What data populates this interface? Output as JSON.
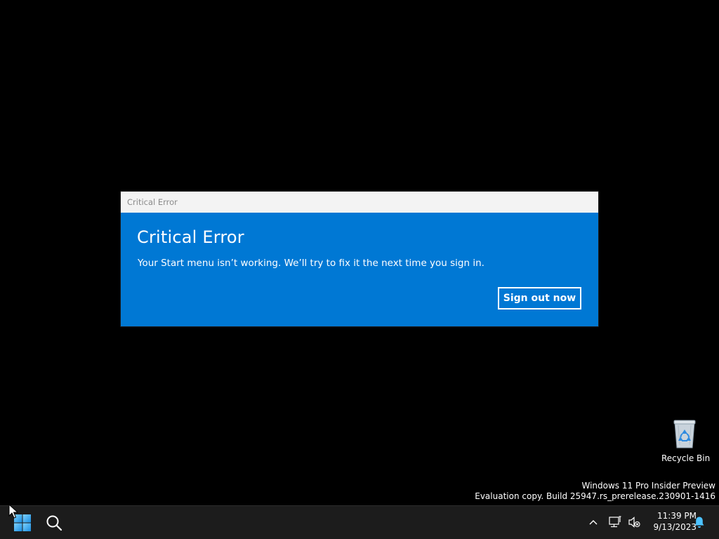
{
  "dialog": {
    "window_title": "Critical Error",
    "heading": "Critical Error",
    "message": "Your Start menu isn’t working. We’ll try to fix it the next time you sign in.",
    "button_label": "Sign out now",
    "accent_color": "#0078d4"
  },
  "desktop": {
    "recycle_bin_label": "Recycle Bin",
    "recycle_bin_icon": "recycle-bin-icon",
    "watermark_line1": "Windows 11 Pro Insider Preview",
    "watermark_line2": "Evaluation copy. Build 25947.rs_prerelease.230901-1416"
  },
  "taskbar": {
    "start_icon": "windows-logo-icon",
    "search_icon": "search-icon",
    "tray_icons": [
      "chevron-up-icon",
      "network-icon",
      "volume-muted-icon",
      "notification-bell-icon"
    ],
    "time": "11:39 PM",
    "date": "9/13/2023",
    "accent_color": "#4cc2ff"
  }
}
